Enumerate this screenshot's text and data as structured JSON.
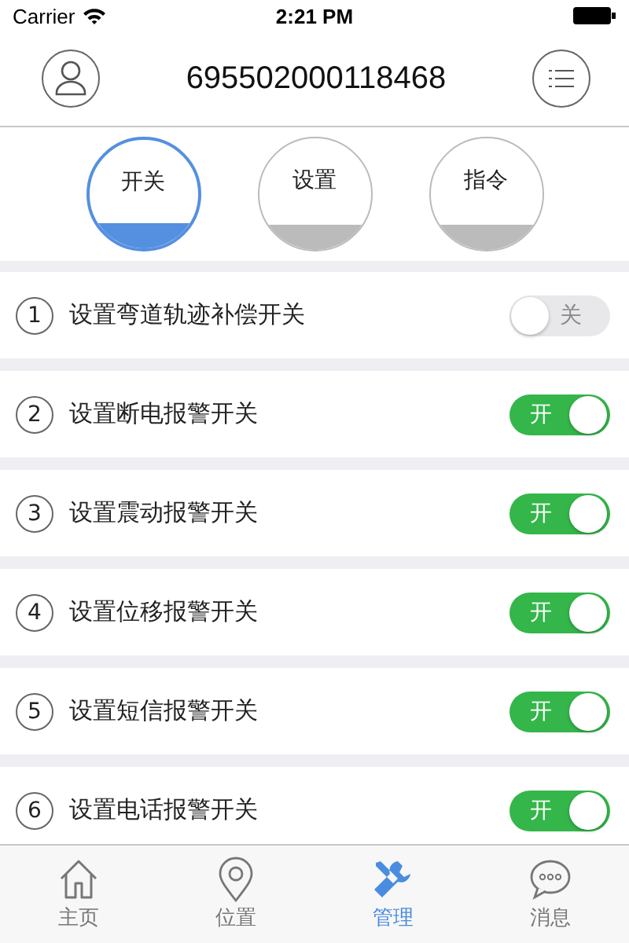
{
  "status_bar": {
    "carrier": "Carrier",
    "time": "2:21 PM"
  },
  "header": {
    "title": "695502000118468"
  },
  "tabs": [
    {
      "label": "开关",
      "selected": true
    },
    {
      "label": "设置",
      "selected": false
    },
    {
      "label": "指令",
      "selected": false
    }
  ],
  "settings": [
    {
      "number": "1",
      "label": "设置弯道轨迹补偿开关",
      "on": false,
      "switch_text": "关"
    },
    {
      "number": "2",
      "label": "设置断电报警开关",
      "on": true,
      "switch_text": "开"
    },
    {
      "number": "3",
      "label": "设置震动报警开关",
      "on": true,
      "switch_text": "开"
    },
    {
      "number": "4",
      "label": "设置位移报警开关",
      "on": true,
      "switch_text": "开"
    },
    {
      "number": "5",
      "label": "设置短信报警开关",
      "on": true,
      "switch_text": "开"
    },
    {
      "number": "6",
      "label": "设置电话报警开关",
      "on": true,
      "switch_text": "开"
    }
  ],
  "tab_bar": [
    {
      "kind": "home",
      "label": "主页",
      "selected": false
    },
    {
      "kind": "location",
      "label": "位置",
      "selected": false
    },
    {
      "kind": "tools",
      "label": "管理",
      "selected": true
    },
    {
      "kind": "message",
      "label": "消息",
      "selected": false
    }
  ]
}
